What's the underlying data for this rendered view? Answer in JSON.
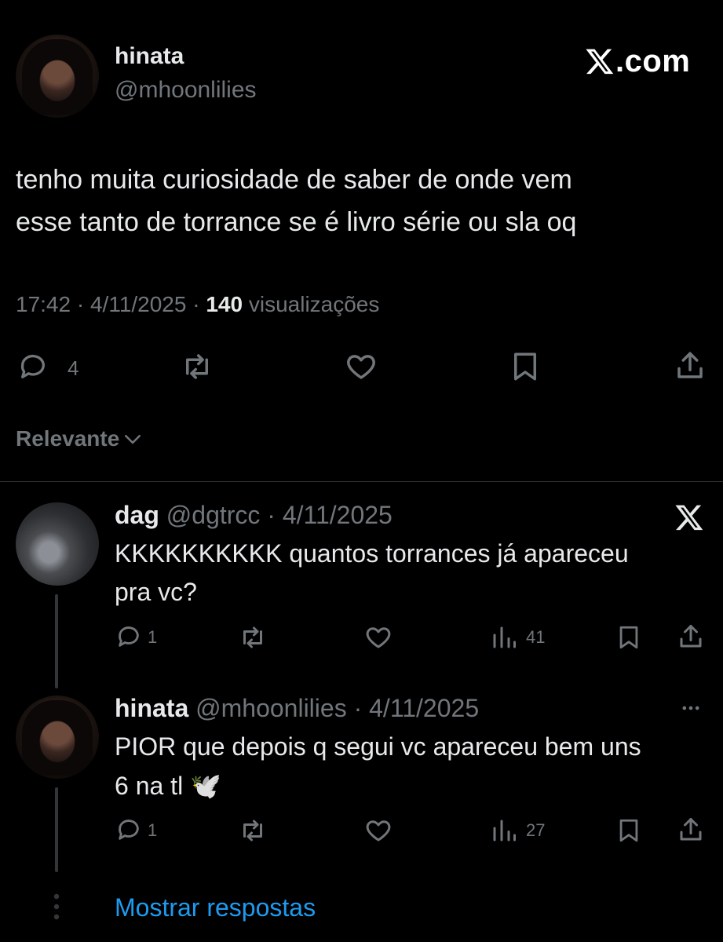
{
  "brand": {
    "logo_text": "X.com"
  },
  "main_post": {
    "author_name": "hinata",
    "author_handle": "@mhoonlilies",
    "text_line1": "tenho muita curiosidade de saber de onde vem",
    "text_line2": "esse tanto de torrance se é livro série ou sla oq",
    "time": "17:42",
    "date": "4/11/2025",
    "views_count": "140",
    "views_label": "visualizações",
    "reply_count": "4"
  },
  "sort": {
    "label": "Relevante"
  },
  "replies": [
    {
      "author_name": "dag",
      "author_handle": "@dgtrcc",
      "date": "4/11/2025",
      "text_line1": "KKKKKKKKKK quantos torrances já apareceu",
      "text_line2": "pra vc?",
      "reply_count": "1",
      "views_count": "41"
    },
    {
      "author_name": "hinata",
      "author_handle": "@mhoonlilies",
      "date": "4/11/2025",
      "text_line1": "PIOR que depois q segui vc apareceu bem uns",
      "text_line2": "6 na tl 🕊️",
      "reply_count": "1",
      "views_count": "27"
    }
  ],
  "show_replies": {
    "label": "Mostrar respostas"
  },
  "icons": {
    "reply": "reply-icon",
    "repost": "repost-icon",
    "like": "heart-icon",
    "bookmark": "bookmark-icon",
    "share": "share-icon",
    "views": "views-icon",
    "more": "more-icon",
    "chevron": "chevron-down-icon",
    "x_logo": "x-logo-icon"
  },
  "colors": {
    "background": "#000000",
    "text": "#e7e9ea",
    "muted": "#71767b",
    "link": "#1d9bf0",
    "divider": "#2f3336"
  }
}
